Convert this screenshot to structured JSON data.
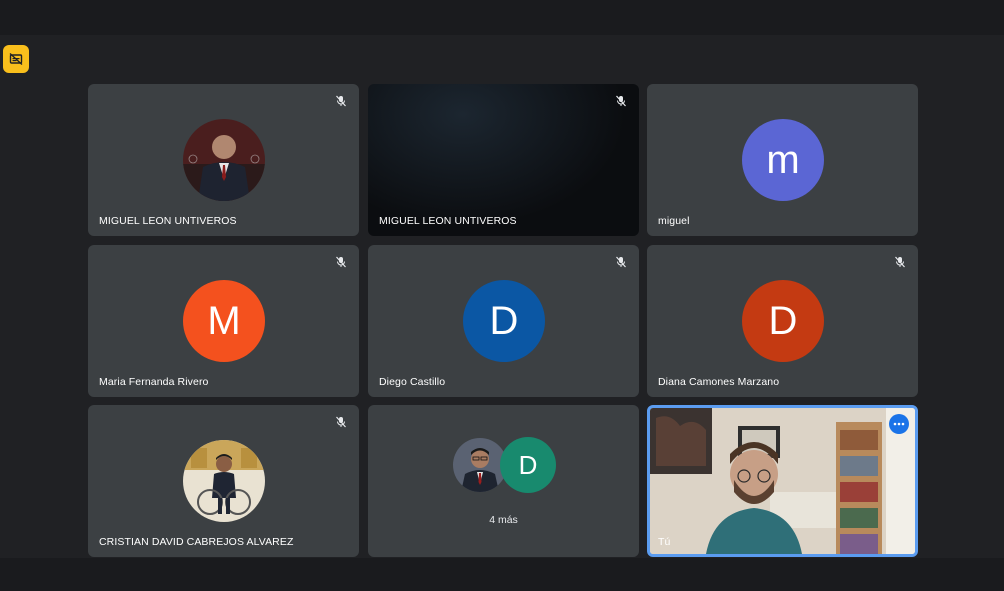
{
  "colors": {
    "background": "#202124",
    "tile": "#3c4043",
    "captions_button": "#f9bf1c",
    "self_border": "#5b9cf0"
  },
  "toolbar": {
    "captions_icon": "captions-off-icon"
  },
  "tiles": [
    {
      "name": "MIGUEL LEON UNTIVEROS",
      "type": "photo",
      "muted": true
    },
    {
      "name": "MIGUEL LEON UNTIVEROS",
      "type": "video-dark",
      "muted": true
    },
    {
      "name": "miguel",
      "type": "letter",
      "letter": "m",
      "color": "#5b66d4",
      "muted": false
    },
    {
      "name": "Maria Fernanda Rivero",
      "type": "letter",
      "letter": "M",
      "color": "#f4511e",
      "muted": true
    },
    {
      "name": "Diego Castillo",
      "type": "letter",
      "letter": "D",
      "color": "#0b57a4",
      "muted": true
    },
    {
      "name": "Diana Camones Marzano",
      "type": "letter",
      "letter": "D",
      "color": "#c43a12",
      "muted": true
    },
    {
      "name": "CRISTIAN DAVID CABREJOS ALVAREZ",
      "type": "photo",
      "muted": true
    },
    {
      "type": "more",
      "letter": "D",
      "label": "4 más"
    },
    {
      "name": "Tú",
      "type": "self-video"
    }
  ]
}
